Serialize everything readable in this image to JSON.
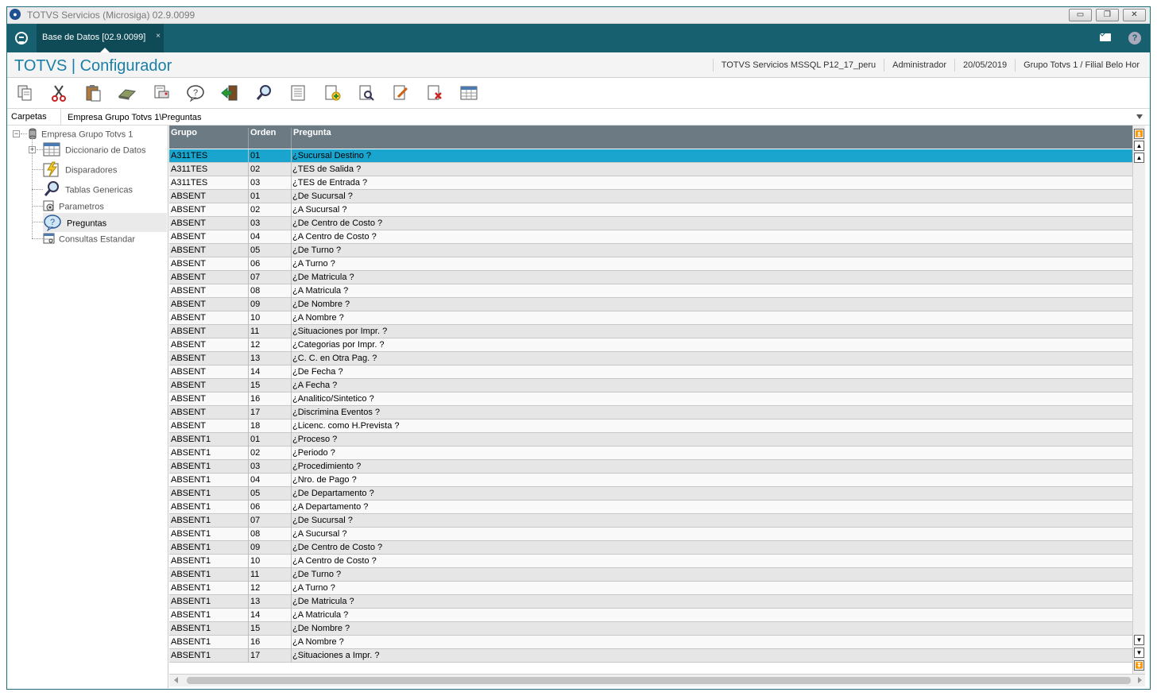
{
  "window": {
    "title": "TOTVS Servicios (Microsiga) 02.9.0099",
    "controls": [
      "minimize-icon",
      "restore-icon",
      "close-icon"
    ]
  },
  "tab": {
    "label": "Base de Datos [02.9.0099]",
    "close": "×"
  },
  "header": {
    "brand": "TOTVS | Configurador",
    "server": "TOTVS Servicios MSSQL P12_17_peru",
    "user": "Administrador",
    "date": "20/05/2019",
    "branch": "Grupo Totvs 1 / Filial Belo Hor"
  },
  "toolbar": {
    "icons": [
      "copy-icon",
      "cut-icon",
      "paste-icon",
      "eraser-icon",
      "print-icon",
      "help-icon",
      "exit-icon",
      "search-icon",
      "list-icon",
      "add-icon",
      "preview-icon",
      "edit-icon",
      "delete-icon",
      "table-icon"
    ]
  },
  "address": {
    "label": "Carpetas",
    "path": "Empresa Grupo Totvs 1\\Preguntas"
  },
  "tree": {
    "root": "Empresa Grupo Totvs 1",
    "items": [
      "Diccionario de Datos",
      "Disparadores",
      "Tablas Genericas",
      "Parametros",
      "Preguntas",
      "Consultas Estandar"
    ]
  },
  "grid": {
    "columns": [
      "Grupo",
      "Orden",
      "Pregunta"
    ],
    "rows": [
      [
        "A311TES",
        "01",
        "¿Sucursal Destino ?"
      ],
      [
        "A311TES",
        "02",
        "¿TES de Salida ?"
      ],
      [
        "A311TES",
        "03",
        "¿TES de Entrada ?"
      ],
      [
        "ABSENT",
        "01",
        "¿De Sucursal ?"
      ],
      [
        "ABSENT",
        "02",
        "¿A Sucursal ?"
      ],
      [
        "ABSENT",
        "03",
        "¿De Centro de Costo ?"
      ],
      [
        "ABSENT",
        "04",
        "¿A Centro de Costo ?"
      ],
      [
        "ABSENT",
        "05",
        "¿De Turno ?"
      ],
      [
        "ABSENT",
        "06",
        "¿A Turno ?"
      ],
      [
        "ABSENT",
        "07",
        "¿De Matricula ?"
      ],
      [
        "ABSENT",
        "08",
        "¿A Matricula ?"
      ],
      [
        "ABSENT",
        "09",
        "¿De Nombre ?"
      ],
      [
        "ABSENT",
        "10",
        "¿A Nombre ?"
      ],
      [
        "ABSENT",
        "11",
        "¿Situaciones por Impr. ?"
      ],
      [
        "ABSENT",
        "12",
        "¿Categorias por Impr. ?"
      ],
      [
        "ABSENT",
        "13",
        "¿C. C. en Otra Pag. ?"
      ],
      [
        "ABSENT",
        "14",
        "¿De Fecha ?"
      ],
      [
        "ABSENT",
        "15",
        "¿A Fecha ?"
      ],
      [
        "ABSENT",
        "16",
        "¿Analitico/Sintetico ?"
      ],
      [
        "ABSENT",
        "17",
        "¿Discrimina Eventos ?"
      ],
      [
        "ABSENT",
        "18",
        "¿Licenc. como H.Prevista ?"
      ],
      [
        "ABSENT1",
        "01",
        "¿Proceso ?"
      ],
      [
        "ABSENT1",
        "02",
        "¿Periodo ?"
      ],
      [
        "ABSENT1",
        "03",
        "¿Procedimiento ?"
      ],
      [
        "ABSENT1",
        "04",
        "¿Nro. de Pago ?"
      ],
      [
        "ABSENT1",
        "05",
        "¿De Departamento ?"
      ],
      [
        "ABSENT1",
        "06",
        "¿A Departamento ?"
      ],
      [
        "ABSENT1",
        "07",
        "¿De Sucursal ?"
      ],
      [
        "ABSENT1",
        "08",
        "¿A Sucursal ?"
      ],
      [
        "ABSENT1",
        "09",
        "¿De Centro de Costo ?"
      ],
      [
        "ABSENT1",
        "10",
        "¿A Centro de Costo ?"
      ],
      [
        "ABSENT1",
        "11",
        "¿De Turno ?"
      ],
      [
        "ABSENT1",
        "12",
        "¿A Turno ?"
      ],
      [
        "ABSENT1",
        "13",
        "¿De Matricula ?"
      ],
      [
        "ABSENT1",
        "14",
        "¿A Matricula ?"
      ],
      [
        "ABSENT1",
        "15",
        "¿De Nombre ?"
      ],
      [
        "ABSENT1",
        "16",
        "¿A Nombre ?"
      ],
      [
        "ABSENT1",
        "17",
        "¿Situaciones a Impr. ?"
      ]
    ]
  }
}
